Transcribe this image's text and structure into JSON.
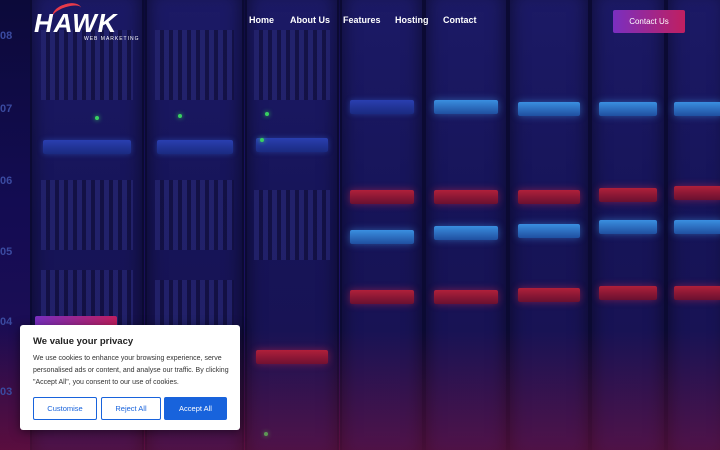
{
  "brand": {
    "logo_text": "HAWK",
    "logo_subtext": "WEB MARKETING"
  },
  "nav": {
    "items": [
      {
        "label": "Home"
      },
      {
        "label": "About Us"
      },
      {
        "label": "Features"
      },
      {
        "label": "Hosting"
      },
      {
        "label": "Contact"
      }
    ],
    "cta_label": "Contact Us"
  },
  "hero": {
    "ruler_marks": [
      "08",
      "07",
      "06",
      "05",
      "04",
      "03"
    ]
  },
  "cookie_banner": {
    "title": "We value your privacy",
    "body": "We use cookies to enhance your browsing experience, serve personalised ads or content, and analyse our traffic. By clicking \"Accept All\", you consent to our use of cookies.",
    "customise_label": "Customise",
    "reject_label": "Reject All",
    "accept_label": "Accept All"
  },
  "colors": {
    "accent_gradient_start": "#7a2fc0",
    "accent_gradient_end": "#c01f60",
    "cookie_primary": "#1863dc",
    "background": "#0a0830"
  }
}
